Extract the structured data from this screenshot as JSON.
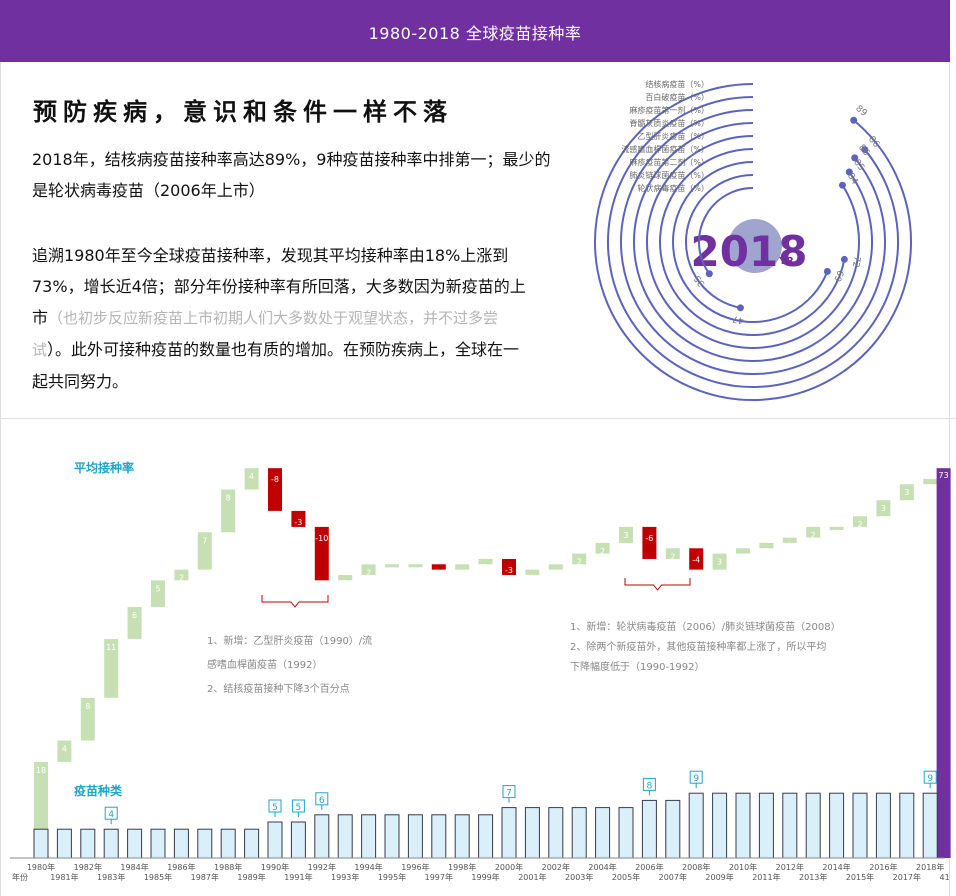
{
  "header": {
    "title": "1980-2018 全球疫苗接种率"
  },
  "headline": "预防疾病，意识和条件一样不落",
  "paragraph1": "2018年，结核病疫苗接种率高达89%，9种疫苗接种率中排第一；最少的是轮状病毒疫苗（2006年上市）",
  "paragraph2_a": "追溯1980年至今全球疫苗接种率，发现其平均接种率由18%上涨到73%，增长近4倍；部分年份接种率有所回落，大多数因为新疫苗的上市",
  "paragraph2_note": "（也初步反应新疫苗上市初期人们大多数处于观望状态，并不过多尝试",
  "paragraph2_b": "）。此外可接种疫苗的数量也有质的增加。在预防疾病上，全球在一起共同努力。",
  "chart_data": [
    {
      "type": "radial-bar",
      "center_label": "2018",
      "center_suffix": "YR.",
      "categories": [
        "结核病疫苗（%）",
        "百白破疫苗（%）",
        "麻疹疫苗第一剂（%）",
        "脊髓灰质炎疫苗（%）",
        "乙型肝炎疫苗（%）",
        "流感嗜血桿菌疫苗（%）",
        "麻疹疫苗第二剂（%）",
        "肺炎链球菌疫苗（%）",
        "轮状病毒疫苗（%）"
      ],
      "values": [
        89,
        86,
        86,
        85,
        84,
        72,
        69,
        47,
        35
      ],
      "colors": {
        "ring": "#5b63be",
        "center_text": "#7030a0",
        "center_circle": "#9fa5ce"
      }
    },
    {
      "type": "waterfall",
      "title": "平均接种率",
      "x": [
        "1980",
        "1981",
        "1982",
        "1983",
        "1984",
        "1985",
        "1986",
        "1987",
        "1988",
        "1989",
        "1990",
        "1991",
        "1992",
        "1993",
        "1994",
        "1995",
        "1996",
        "1997",
        "1998",
        "1999",
        "2000",
        "2001",
        "2002",
        "2003",
        "2004",
        "2005",
        "2006",
        "2007",
        "2008",
        "2009",
        "2010",
        "2011",
        "2012",
        "2013",
        "2014",
        "2015",
        "2016",
        "2017",
        "2018"
      ],
      "start": 18,
      "deltas": [
        4,
        8,
        11,
        6,
        5,
        2,
        7,
        8,
        4,
        -8,
        -3,
        -10,
        1,
        2,
        0,
        0,
        -1,
        1,
        1,
        -3,
        1,
        1,
        2,
        2,
        3,
        -6,
        2,
        -4,
        3,
        1,
        1,
        1,
        2,
        0,
        2,
        3,
        3,
        1,
        1
      ],
      "total_label": "41",
      "total_value": 73,
      "colors": {
        "increase": "#c6e0b4",
        "decrease": "#c00000",
        "total": "#7030a0"
      },
      "annotations": [
        [
          "1、新增：乙型肝炎疫苗（1990）/流",
          "感嗜血桿菌疫苗（1992）",
          "2、结核疫苗接种下降3个百分点"
        ],
        [
          "1、新增：轮状病毒疫苗（2006）/肺炎链球菌疫苗（2008）",
          "2、除两个新疫苗外，其他疫苗接种率都上涨了，所以平均",
          "下降幅度低于（1990-1992）"
        ]
      ]
    },
    {
      "type": "bar",
      "title": "疫苗种类",
      "x": [
        "1980",
        "1981",
        "1982",
        "1983",
        "1984",
        "1985",
        "1986",
        "1987",
        "1988",
        "1989",
        "1990",
        "1991",
        "1992",
        "1993",
        "1994",
        "1995",
        "1996",
        "1997",
        "1998",
        "1999",
        "2000",
        "2001",
        "2002",
        "2003",
        "2004",
        "2005",
        "2006",
        "2007",
        "2008",
        "2009",
        "2010",
        "2011",
        "2012",
        "2013",
        "2014",
        "2015",
        "2016",
        "2017",
        "2018"
      ],
      "x_tick_labels": [
        "1980年",
        "1981年",
        "1982年",
        "1983年",
        "1984年",
        "1985年",
        "1986年",
        "1987年",
        "1988年",
        "1989年",
        "1990年",
        "1991年",
        "1992年",
        "1993年",
        "1994年",
        "1995年",
        "1996年",
        "1997年",
        "1998年",
        "1999年",
        "2000年",
        "2001年",
        "2002年",
        "2003年",
        "2004年",
        "2005年",
        "2006年",
        "2007年",
        "2008年",
        "2009年",
        "2010年",
        "2011年",
        "2012年",
        "2013年",
        "2014年",
        "2015年",
        "2016年",
        "2017年",
        "2018年"
      ],
      "values": [
        4,
        4,
        4,
        4,
        4,
        4,
        4,
        4,
        4,
        4,
        5,
        5,
        6,
        6,
        6,
        6,
        6,
        6,
        6,
        6,
        7,
        7,
        7,
        7,
        7,
        7,
        8,
        8,
        9,
        9,
        9,
        9,
        9,
        9,
        9,
        9,
        9,
        9,
        9
      ],
      "labeled": {
        "3": "4",
        "10": "5",
        "11": "5",
        "12": "6",
        "20": "7",
        "26": "8",
        "28": "9",
        "38": "9"
      },
      "x_axis_label": "年份",
      "colors": {
        "fill": "#d9f0fa",
        "stroke": "#3a3a4a",
        "label": "#22a6c8"
      }
    }
  ]
}
